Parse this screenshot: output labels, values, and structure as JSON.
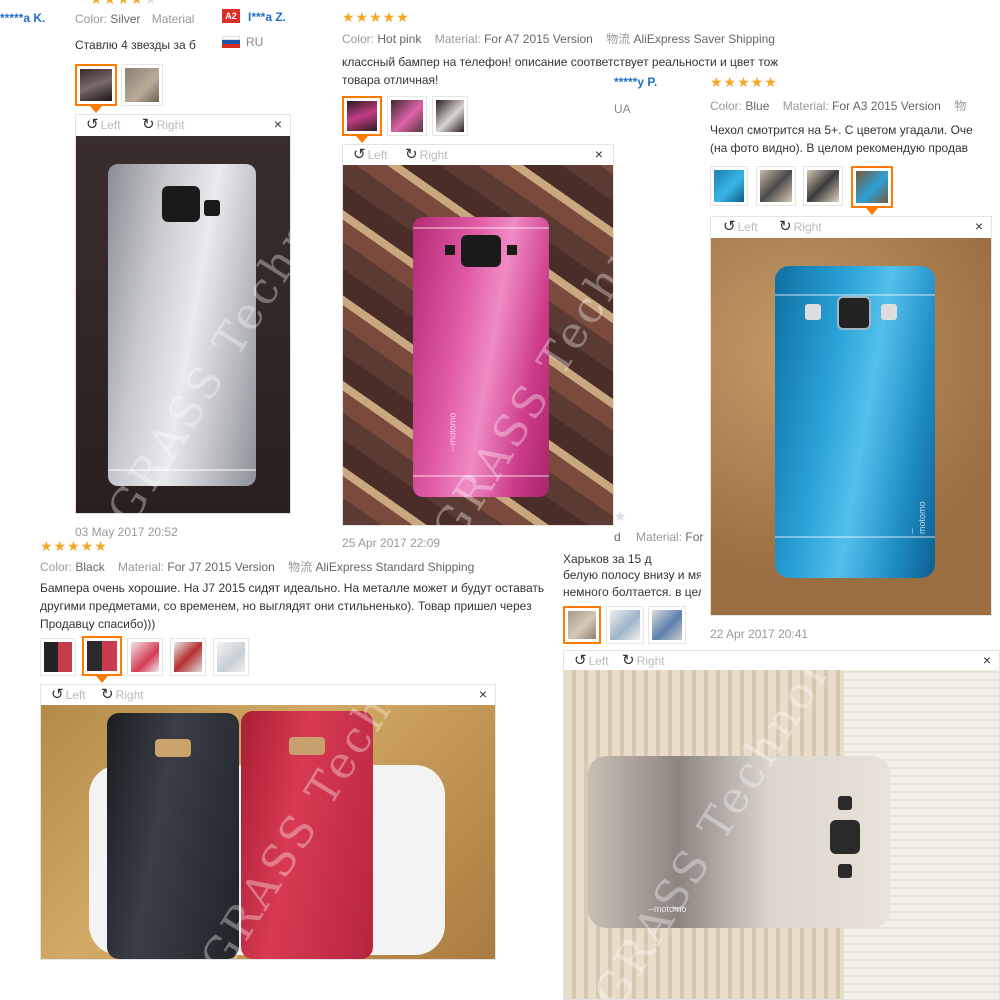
{
  "colors": {
    "star": "#f5a623",
    "accent": "#ff7a00",
    "user": "#1f6fc5"
  },
  "review1": {
    "user": "I***a Z.",
    "country_code": "RU",
    "badge": "A2",
    "color_label": "Color:",
    "color_value": "Silver",
    "material_label": "Material",
    "text": "Ставлю 4 звезды за б",
    "date": "03 May 2017 20:52",
    "rating": 4
  },
  "review2": {
    "color_label": "Color:",
    "color_value": "Hot pink",
    "material_label": "Material:",
    "material_value": "For A7 2015 Version",
    "shipping_label": "物流",
    "shipping_value": "AliExpress Saver Shipping",
    "text_line1": "классный бампер на телефон! описание соответствует реальности и цвет тож",
    "text_line2": "товара отличная!",
    "date": "25 Apr 2017 22:09",
    "rating": 5
  },
  "review3": {
    "user": "*****y P.",
    "country_code": "UA",
    "color_label": "Color:",
    "color_value": "Blue",
    "material_label": "Material:",
    "material_value": "For A3 2015 Version",
    "shipping_label": "物",
    "text_line1": "Чехол смотрится на 5+. С цветом угадали. Оче",
    "text_line2": "(на фото видно). В целом рекомендую продав",
    "date": "22 Apr 2017 20:41",
    "rating": 5
  },
  "review4": {
    "color_label": "Color:",
    "color_value": "Black",
    "material_label": "Material:",
    "material_value": "For J7 2015 Version",
    "shipping_label": "物流",
    "shipping_value": "AliExpress Standard Shipping",
    "text_line1": "Бампера очень хорошие. На J7 2015 сидят идеально. На металле может и будут оставать",
    "text_line2": "другими предметами, со временем, но выглядят они стильненько). Товар пришел через",
    "text_line3": "Продавцу спасибо)))",
    "rating": 5
  },
  "review5": {
    "material_label": "Material:",
    "material_value": "For",
    "text_line1": "Харьков за 15 д",
    "text_line2": "белую полосу внизу и мя",
    "text_line3": "немного болтается. в цел",
    "rating": 1
  },
  "top_left_user": "*****a K.",
  "viewer": {
    "left_label": "Left",
    "right_label": "Right",
    "close_symbol": "×"
  },
  "photo_logo": "--motomo",
  "watermark": "GRASS Technology"
}
